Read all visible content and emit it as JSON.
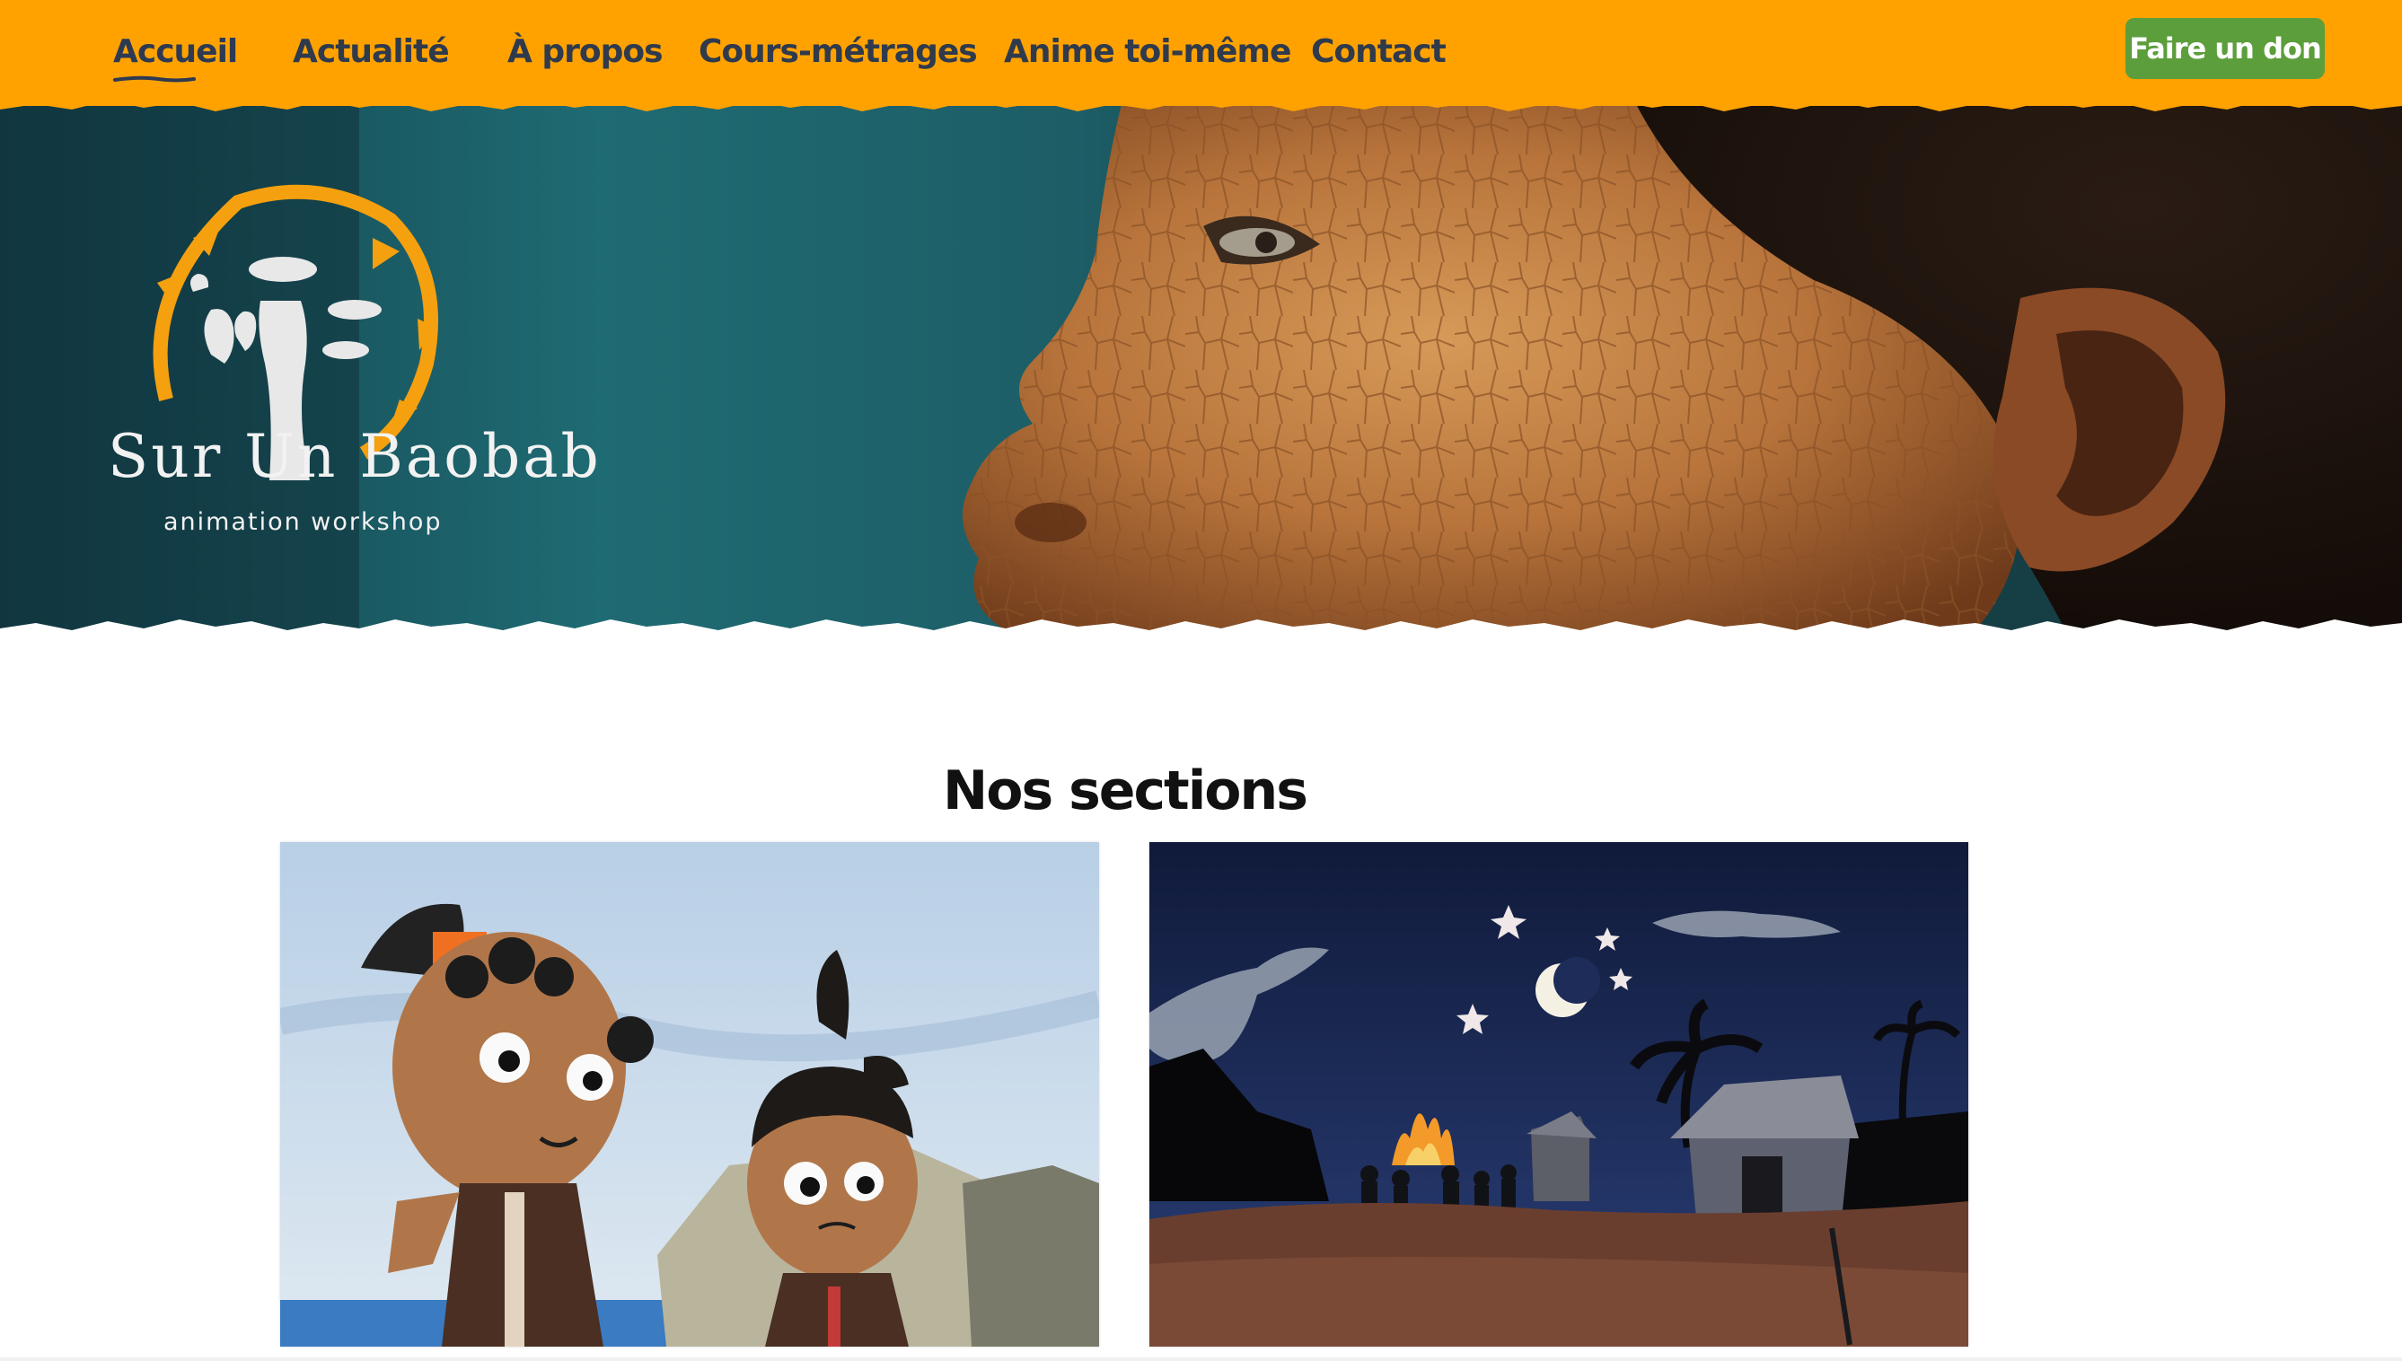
{
  "nav": {
    "items": [
      {
        "label": "Accueil",
        "active": true
      },
      {
        "label": "Actualité",
        "active": false
      },
      {
        "label": "À propos",
        "active": false
      },
      {
        "label": "Cours-métrages",
        "active": false
      },
      {
        "label": "Anime toi-même",
        "active": false
      },
      {
        "label": "Contact",
        "active": false
      }
    ],
    "donate_label": "Faire un don"
  },
  "hero": {
    "logo_title": "Sur Un Baobab",
    "logo_subtitle": "animation workshop"
  },
  "sections": {
    "title": "Nos sections",
    "cards": [
      {
        "image": "paper-cutout-children-animation"
      },
      {
        "image": "night-village-animation"
      }
    ]
  },
  "colors": {
    "nav_bg": "#ffa200",
    "nav_text": "#2f3a4c",
    "donate_bg": "#5b9e3b",
    "logo_orange": "#f5a00f"
  }
}
